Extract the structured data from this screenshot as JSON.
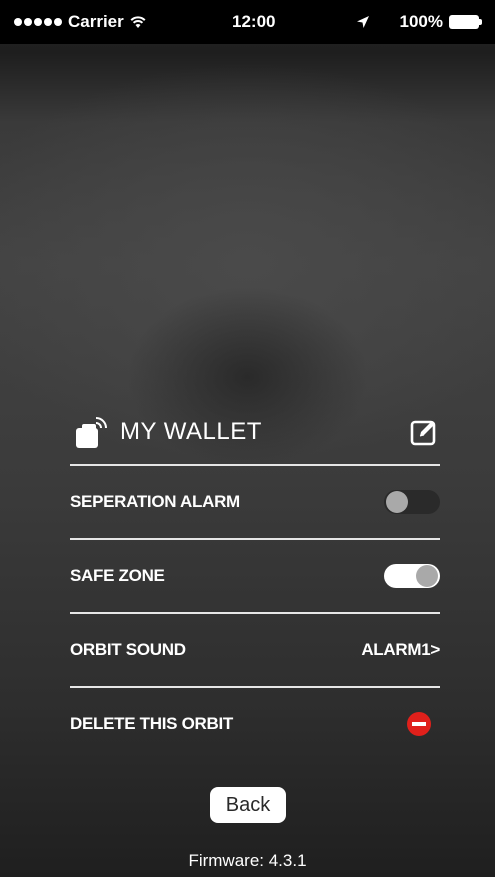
{
  "status_bar": {
    "carrier": "Carrier",
    "time": "12:00",
    "battery": "100%"
  },
  "device": {
    "name": "MY WALLET",
    "icon": "wallet-tracker-icon"
  },
  "settings": {
    "separation_alarm": {
      "label": "SEPERATION ALARM",
      "state": "off"
    },
    "safe_zone": {
      "label": "SAFE ZONE",
      "state": "on"
    },
    "orbit_sound": {
      "label": "ORBIT SOUND",
      "value": "ALARM1>"
    },
    "delete": {
      "label": "DELETE THIS ORBIT"
    }
  },
  "back_label": "Back",
  "firmware": "Firmware: 4.3.1",
  "colors": {
    "delete_red": "#e0201b",
    "toggle_on_track": "#ffffff",
    "toggle_off_track": "#2a2a2a",
    "toggle_knob": "#a9a9a9",
    "divider": "#e6e6e6"
  }
}
